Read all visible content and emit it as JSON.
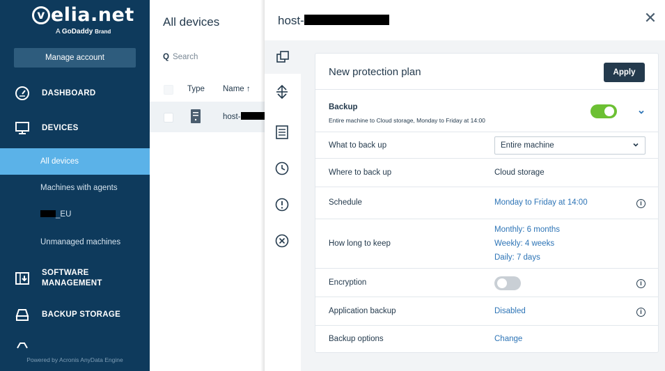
{
  "sidebar": {
    "logo_main": "velia.net",
    "logo_circle": "v",
    "logo_sub_prefix": "A",
    "logo_sub_brand": "GoDaddy",
    "logo_sub_suffix": "Brand",
    "manage_account": "Manage account",
    "nav": [
      {
        "label": "DASHBOARD",
        "icon": "dashboard-gauge-icon"
      },
      {
        "label": "DEVICES",
        "icon": "monitor-icon"
      },
      {
        "label": "SOFTWARE",
        "label2": "MANAGEMENT",
        "icon": "software-install-icon"
      },
      {
        "label": "BACKUP STORAGE",
        "icon": "storage-drive-icon"
      }
    ],
    "sub_items": [
      "All devices",
      "Machines with agents",
      "_EU",
      "Unmanaged machines"
    ],
    "powered_by": "Powered by Acronis AnyData Engine"
  },
  "devices": {
    "title": "All devices",
    "search_placeholder": "Search",
    "col_type": "Type",
    "col_name": "Name ↑",
    "row_name_prefix": "host-"
  },
  "drawer": {
    "title_prefix": "host-",
    "plan_name": "New protection plan",
    "apply": "Apply",
    "backup_title": "Backup",
    "backup_desc": "Entire machine to Cloud storage, Monday to Friday at 14:00",
    "backup_enabled": true,
    "rows": {
      "what_label": "What to back up",
      "what_value": "Entire machine",
      "where_label": "Where to back up",
      "where_value": "Cloud storage",
      "schedule_label": "Schedule",
      "schedule_value": "Monday to Friday at 14:00",
      "keep_label": "How long to keep",
      "keep_monthly": "Monthly: 6 months",
      "keep_weekly": "Weekly: 4 weeks",
      "keep_daily": "Daily: 7 days",
      "encryption_label": "Encryption",
      "encryption_enabled": false,
      "app_label": "Application backup",
      "app_value": "Disabled",
      "options_label": "Backup options",
      "options_value": "Change"
    }
  },
  "colors": {
    "sidebar_bg": "#0e3a5c",
    "active_item": "#5bb2e8",
    "toggle_on": "#6cc033",
    "link": "#2d74b6",
    "apply_bg": "#243a4d"
  }
}
